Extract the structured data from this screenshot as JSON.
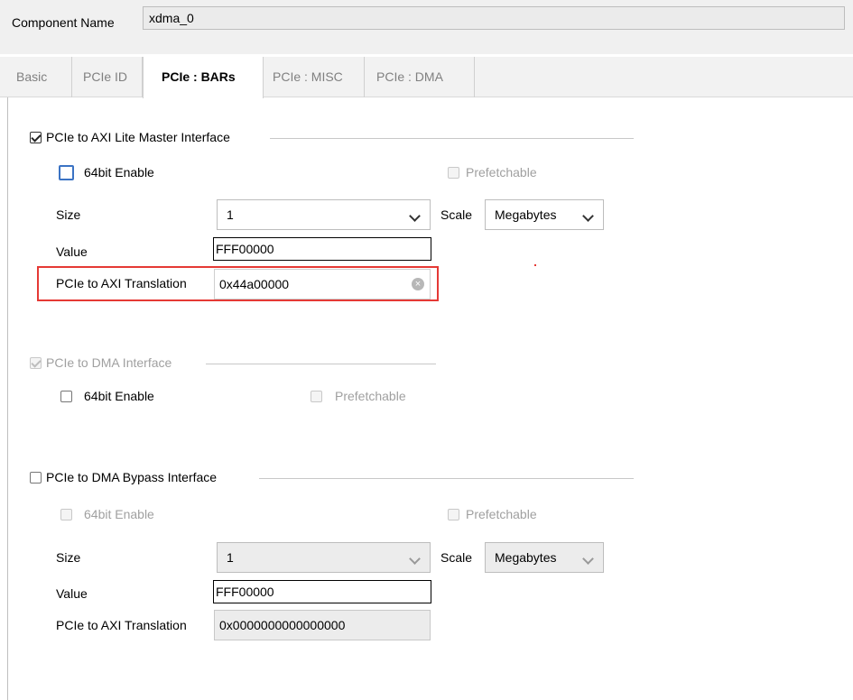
{
  "header": {
    "component_name_label": "Component Name",
    "component_name_value": "xdma_0"
  },
  "tabs": [
    {
      "label": "Basic",
      "active": false
    },
    {
      "label": "PCIe ID",
      "active": false
    },
    {
      "label": "PCIe : BARs",
      "active": true
    },
    {
      "label": "PCIe : MISC",
      "active": false
    },
    {
      "label": "PCIe : DMA",
      "active": false
    }
  ],
  "axi_lite": {
    "title": "PCIe to AXI Lite Master Interface",
    "checked": true,
    "enable64_label": "64bit Enable",
    "prefetch_label": "Prefetchable",
    "size_label": "Size",
    "size_value": "1",
    "scale_label": "Scale",
    "scale_value": "Megabytes",
    "value_label": "Value",
    "value_value": "FFF00000",
    "translation_label": "PCIe to AXI Translation",
    "translation_value": "0x44a00000"
  },
  "dma": {
    "title": "PCIe to DMA Interface",
    "checked": true,
    "enable64_label": "64bit Enable",
    "prefetch_label": "Prefetchable"
  },
  "bypass": {
    "title": "PCIe to DMA Bypass Interface",
    "checked": false,
    "enable64_label": "64bit Enable",
    "prefetch_label": "Prefetchable",
    "size_label": "Size",
    "size_value": "1",
    "scale_label": "Scale",
    "scale_value": "Megabytes",
    "value_label": "Value",
    "value_value": "FFF00000",
    "translation_label": "PCIe to AXI Translation",
    "translation_value": "0x0000000000000000"
  },
  "colors": {
    "highlight": "#e53935",
    "focus": "#3b73c4"
  }
}
